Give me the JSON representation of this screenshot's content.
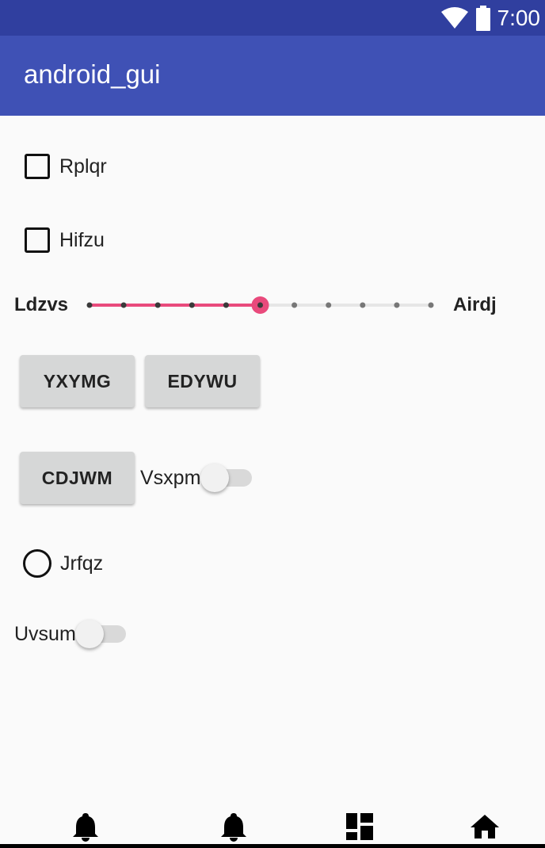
{
  "status_bar": {
    "time": "7:00",
    "icons": [
      "wifi-icon",
      "battery-icon"
    ],
    "color": "#303f9f"
  },
  "app_bar": {
    "title": "android_gui",
    "color": "#3f51b5"
  },
  "checkboxes": [
    {
      "label": "Rplqr",
      "checked": false
    },
    {
      "label": "Hifzu",
      "checked": false
    }
  ],
  "slider": {
    "min_label": "Ldzvs",
    "max_label": "Airdj",
    "steps": 10,
    "value": 5,
    "accent": "#e94a7c"
  },
  "buttons": {
    "b1": "YXYMG",
    "b2": "EDYWU",
    "b3": "CDJWM"
  },
  "switches": [
    {
      "label": "Vsxpm",
      "on": false
    },
    {
      "label": "Uvsum",
      "on": false
    }
  ],
  "radio": {
    "label": "Jrfqz",
    "selected": false
  },
  "bottom_nav": {
    "items": [
      "bell-icon",
      "bell-icon",
      "dashboard-icon",
      "home-icon"
    ]
  }
}
